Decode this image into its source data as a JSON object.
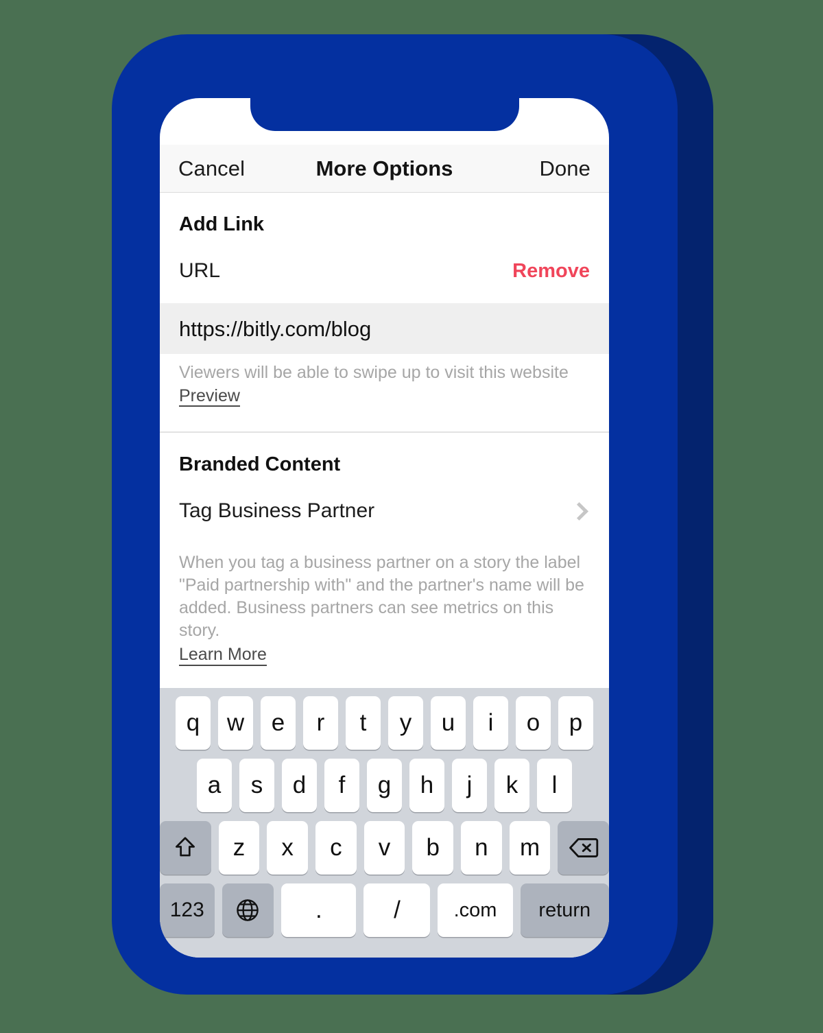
{
  "theme": {
    "background": "#4a7052",
    "phone_body": "#0430a0",
    "phone_shadow": "#04236e",
    "accent_remove": "#f0455a",
    "keyboard_bg": "#d1d5db",
    "key_bg": "#ffffff",
    "mod_key_bg": "#adb3bd",
    "url_field_bg": "#efefef"
  },
  "navbar": {
    "cancel_label": "Cancel",
    "title": "More Options",
    "done_label": "Done"
  },
  "add_link": {
    "header": "Add Link",
    "url_label": "URL",
    "remove_label": "Remove",
    "url_value": "https://bitly.com/blog",
    "helper_text": "Viewers will be able to swipe up to visit this website",
    "preview_label": "Preview"
  },
  "branded_content": {
    "header": "Branded Content",
    "tag_partner_label": "Tag Business Partner",
    "chevron_icon": "chevron-right-icon",
    "description": "When you tag a business partner on a story the label \"Paid partnership with\" and the partner's name will be added. Business partners can see metrics on this story.",
    "learn_more_label": "Learn More"
  },
  "keyboard": {
    "layout": "url",
    "row1": [
      "q",
      "w",
      "e",
      "r",
      "t",
      "y",
      "u",
      "i",
      "o",
      "p"
    ],
    "row2": [
      "a",
      "s",
      "d",
      "f",
      "g",
      "h",
      "j",
      "k",
      "l"
    ],
    "row3_letters": [
      "z",
      "x",
      "c",
      "v",
      "b",
      "n",
      "m"
    ],
    "shift_icon": "shift-up-arrow-icon",
    "backspace_icon": "backspace-delete-icon",
    "numbers_label": "123",
    "globe_icon": "globe-language-icon",
    "period_label": ".",
    "slash_label": "/",
    "dotcom_label": ".com",
    "return_label": "return"
  }
}
